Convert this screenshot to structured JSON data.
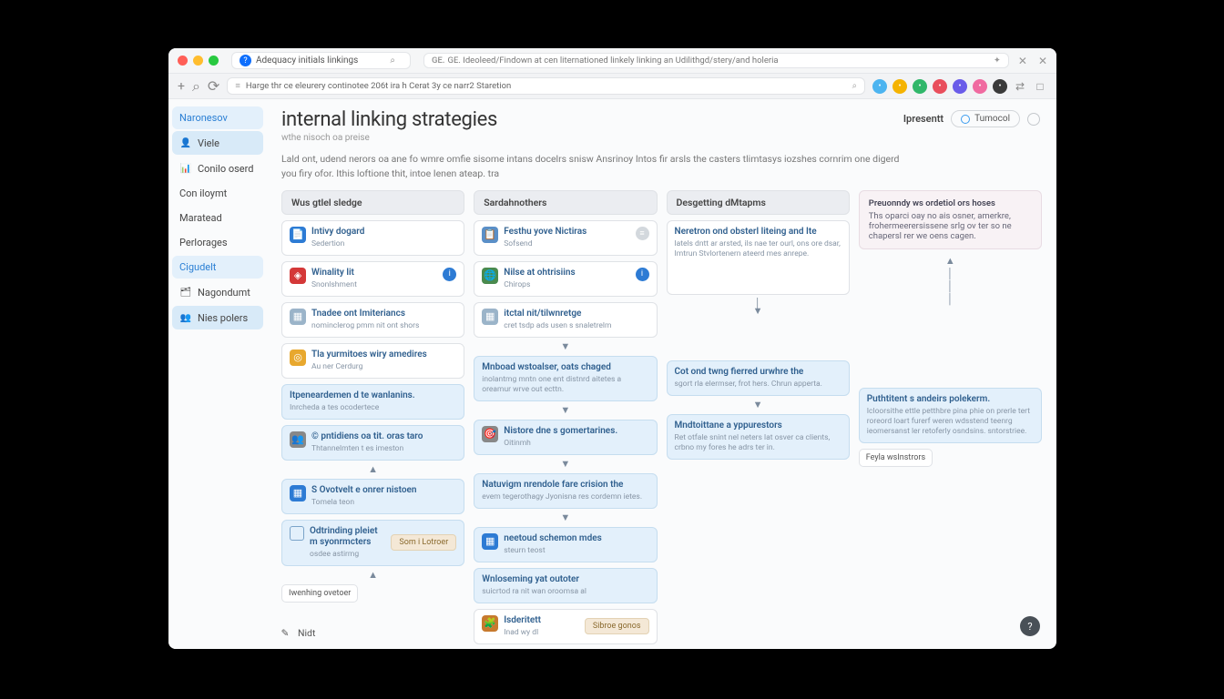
{
  "titlebar": {
    "tab_label": "Adequacy initials linkings",
    "search_text": "GE. Ideoleed/Findown at cen liternationed linkely linking an Udilithgd/stery/and holeria",
    "close_x": "✕"
  },
  "addrbar": {
    "url": "Harge thr ce eleurery continotee 206t ira h Cerat 3y ce narr2 Staretion",
    "ext_colors": [
      "#4cb4f0",
      "#f5b301",
      "#30b76a",
      "#e94e5c",
      "#6a5ce9",
      "#f06aa0",
      "#3a3a3a"
    ]
  },
  "sidebar": {
    "items": [
      {
        "icon": "",
        "label": "Naronesov",
        "sel": true,
        "active": false
      },
      {
        "icon": "👤",
        "label": "Viele",
        "sel": false,
        "active": true
      },
      {
        "icon": "📊",
        "label": "Conilo oserd",
        "sel": false,
        "active": false
      },
      {
        "icon": "",
        "label": "Con iloymt",
        "sel": false,
        "active": false
      },
      {
        "icon": "",
        "label": "Maratead",
        "sel": false,
        "active": false
      },
      {
        "icon": "",
        "label": "Perlorages",
        "sel": false,
        "active": false
      },
      {
        "icon": "",
        "label": "Cigudelt",
        "sel": true,
        "active": false
      },
      {
        "icon": "🗂",
        "label": "Nagondumt",
        "sel": false,
        "active": false
      },
      {
        "icon": "👥",
        "label": "Nies polers",
        "sel": false,
        "active": true
      }
    ]
  },
  "page": {
    "title": "internal linking strategies",
    "subtitle": "wthe nisoch oa preise",
    "intro": "Lald ont, udend nerors oa ane fo wmre omfie sisome intans docelrs snisw Ansrinoy Intos fir arsls the casters tlimtasys iozshes cornrim one digerd you firy ofor. Ithis loftione thit, intoe Ienen ateap. tra",
    "present": "Ipresentt",
    "pill": "Tumocol"
  },
  "cols": {
    "c1": {
      "head": "Wus gtlel sledge",
      "cards": [
        {
          "ic": "📄",
          "icbg": "#2d7bd4",
          "t1": "Intivy dogard",
          "t2": "Sedertion",
          "blue": false
        },
        {
          "ic": "◈",
          "icbg": "#d43838",
          "t1": "Winality lit",
          "t2": "Snonlshment",
          "blue": false,
          "badge": "#2d7bd4"
        },
        {
          "ic": "▦",
          "icbg": "#9bb4c9",
          "t1": "Tnadee ont Imiteriancs",
          "t2": "nominclerog pmm nit ont shors",
          "blue": false
        },
        {
          "ic": "◎",
          "icbg": "#e8a82e",
          "t1": "Tla yurmitoes wiry amedires",
          "t2": "Au ner Cerdurg",
          "blue": false
        }
      ],
      "flow": [
        {
          "t1": "Itpeneardemen d te wanlanins.",
          "t2": "Inrcheda a tes ocodertece",
          "blue": true
        },
        {
          "t1": "© pntidiens oa tit. oras taro",
          "t2": "Thtannelmten t es imeston",
          "blue": true,
          "ic": "👥"
        }
      ],
      "flow2": [
        {
          "t1": "S Ovotvelt e onrer nistoen",
          "t2": "Tomela teon",
          "blue": true,
          "ic": "▦",
          "icbg": "#2d7bd4"
        },
        {
          "t1": "Odtrinding pleiet m syonrmcters",
          "t2": "osdee astirmg",
          "blue": true,
          "chip": "Som i Lotroer",
          "sq": true
        }
      ],
      "route": "Iwenhing ovetoer"
    },
    "c2": {
      "head": "Sardahnothers",
      "cards": [
        {
          "ic": "📋",
          "icbg": "#5a8fc7",
          "t1": "Festhu yove Nictiras",
          "t2": "Sofsend",
          "badge": "#d3d8dd",
          "bico": "≡"
        },
        {
          "ic": "🌐",
          "icbg": "#4a8a4e",
          "t1": "Nilse at ohtrisiins",
          "t2": "Chirops",
          "badge": "#2d7bd4"
        },
        {
          "ic": "▦",
          "icbg": "#9bb4c9",
          "t1": "itctal nit/tilwnretge",
          "t2": "cret tsdp ads usen s snaletrelm"
        }
      ],
      "flow": [
        {
          "t1": "Mnboad wstoalser, oats chaged",
          "t2": "inolantmg mntn one ent distnrd aitetes a oreamur wrve out ecttn.",
          "blue": true
        },
        {
          "t1": "Nistore dne s gomertarines.",
          "t2": "Oitinmh",
          "blue": true,
          "ic": "🎯"
        },
        {
          "t1": "Natuvigm nrendole fare crision the",
          "t2": "evem tegerothagy Jyonisna res cordemn ietes.",
          "blue": true
        }
      ],
      "flow2": [
        {
          "t1": "neetoud schemon mdes",
          "t2": "steurn teost",
          "blue": true,
          "ic": "▦",
          "icbg": "#2d7bd4"
        },
        {
          "t1": "Wnloseming yat outoter",
          "t2": "suicrtod ra nit wan oroomsa al",
          "blue": true
        },
        {
          "ic": "🧩",
          "icbg": "#c77a2e",
          "t1": "Isderitett",
          "t2": "Inad wy dl",
          "chip": "Sibroe gonos"
        }
      ]
    },
    "c3": {
      "head": "Desgetting dMtapms",
      "info": {
        "t1": "Neretron ond obsterl liteing and Ite",
        "t2": "latels dntt ar arsted, ils nae ter ourl, ons ore dsar, Imtrun Stvlortenern ateerd mes anrepe."
      },
      "flow": [
        {
          "t1": "Cot ond twng fierred urwhre the",
          "t2": "sgort rla elermser, frot hers. Chrun apperta.",
          "blue": true
        },
        {
          "t1": "Mndtoittane a yppurestors",
          "t2": "Ret otfale snint nel neters lat osver ca clients, crbno my fores he adrs ter in.",
          "blue": true
        }
      ]
    },
    "c4": {
      "info": {
        "ib_t": "Preuonndy ws ordetiol ors hoses",
        "t2": "Ths oparci oay no ais osner, amerkre, frohermeerersissene srlg ov ter so ne chapersl rer we oens cagen."
      },
      "flow": [
        {
          "t1": "Puthtitent s andeirs polekerm.",
          "t2": "Icloorsithe ettle petthbre pina phie on prerle tert roreord loart furerf weren wdsstend teenrg ieomersanst ler retoferly osndsins. sntorstriee.",
          "blue": true
        }
      ],
      "tag": "Feyla wsInstrors"
    }
  },
  "footer": {
    "label": "Nidt"
  }
}
